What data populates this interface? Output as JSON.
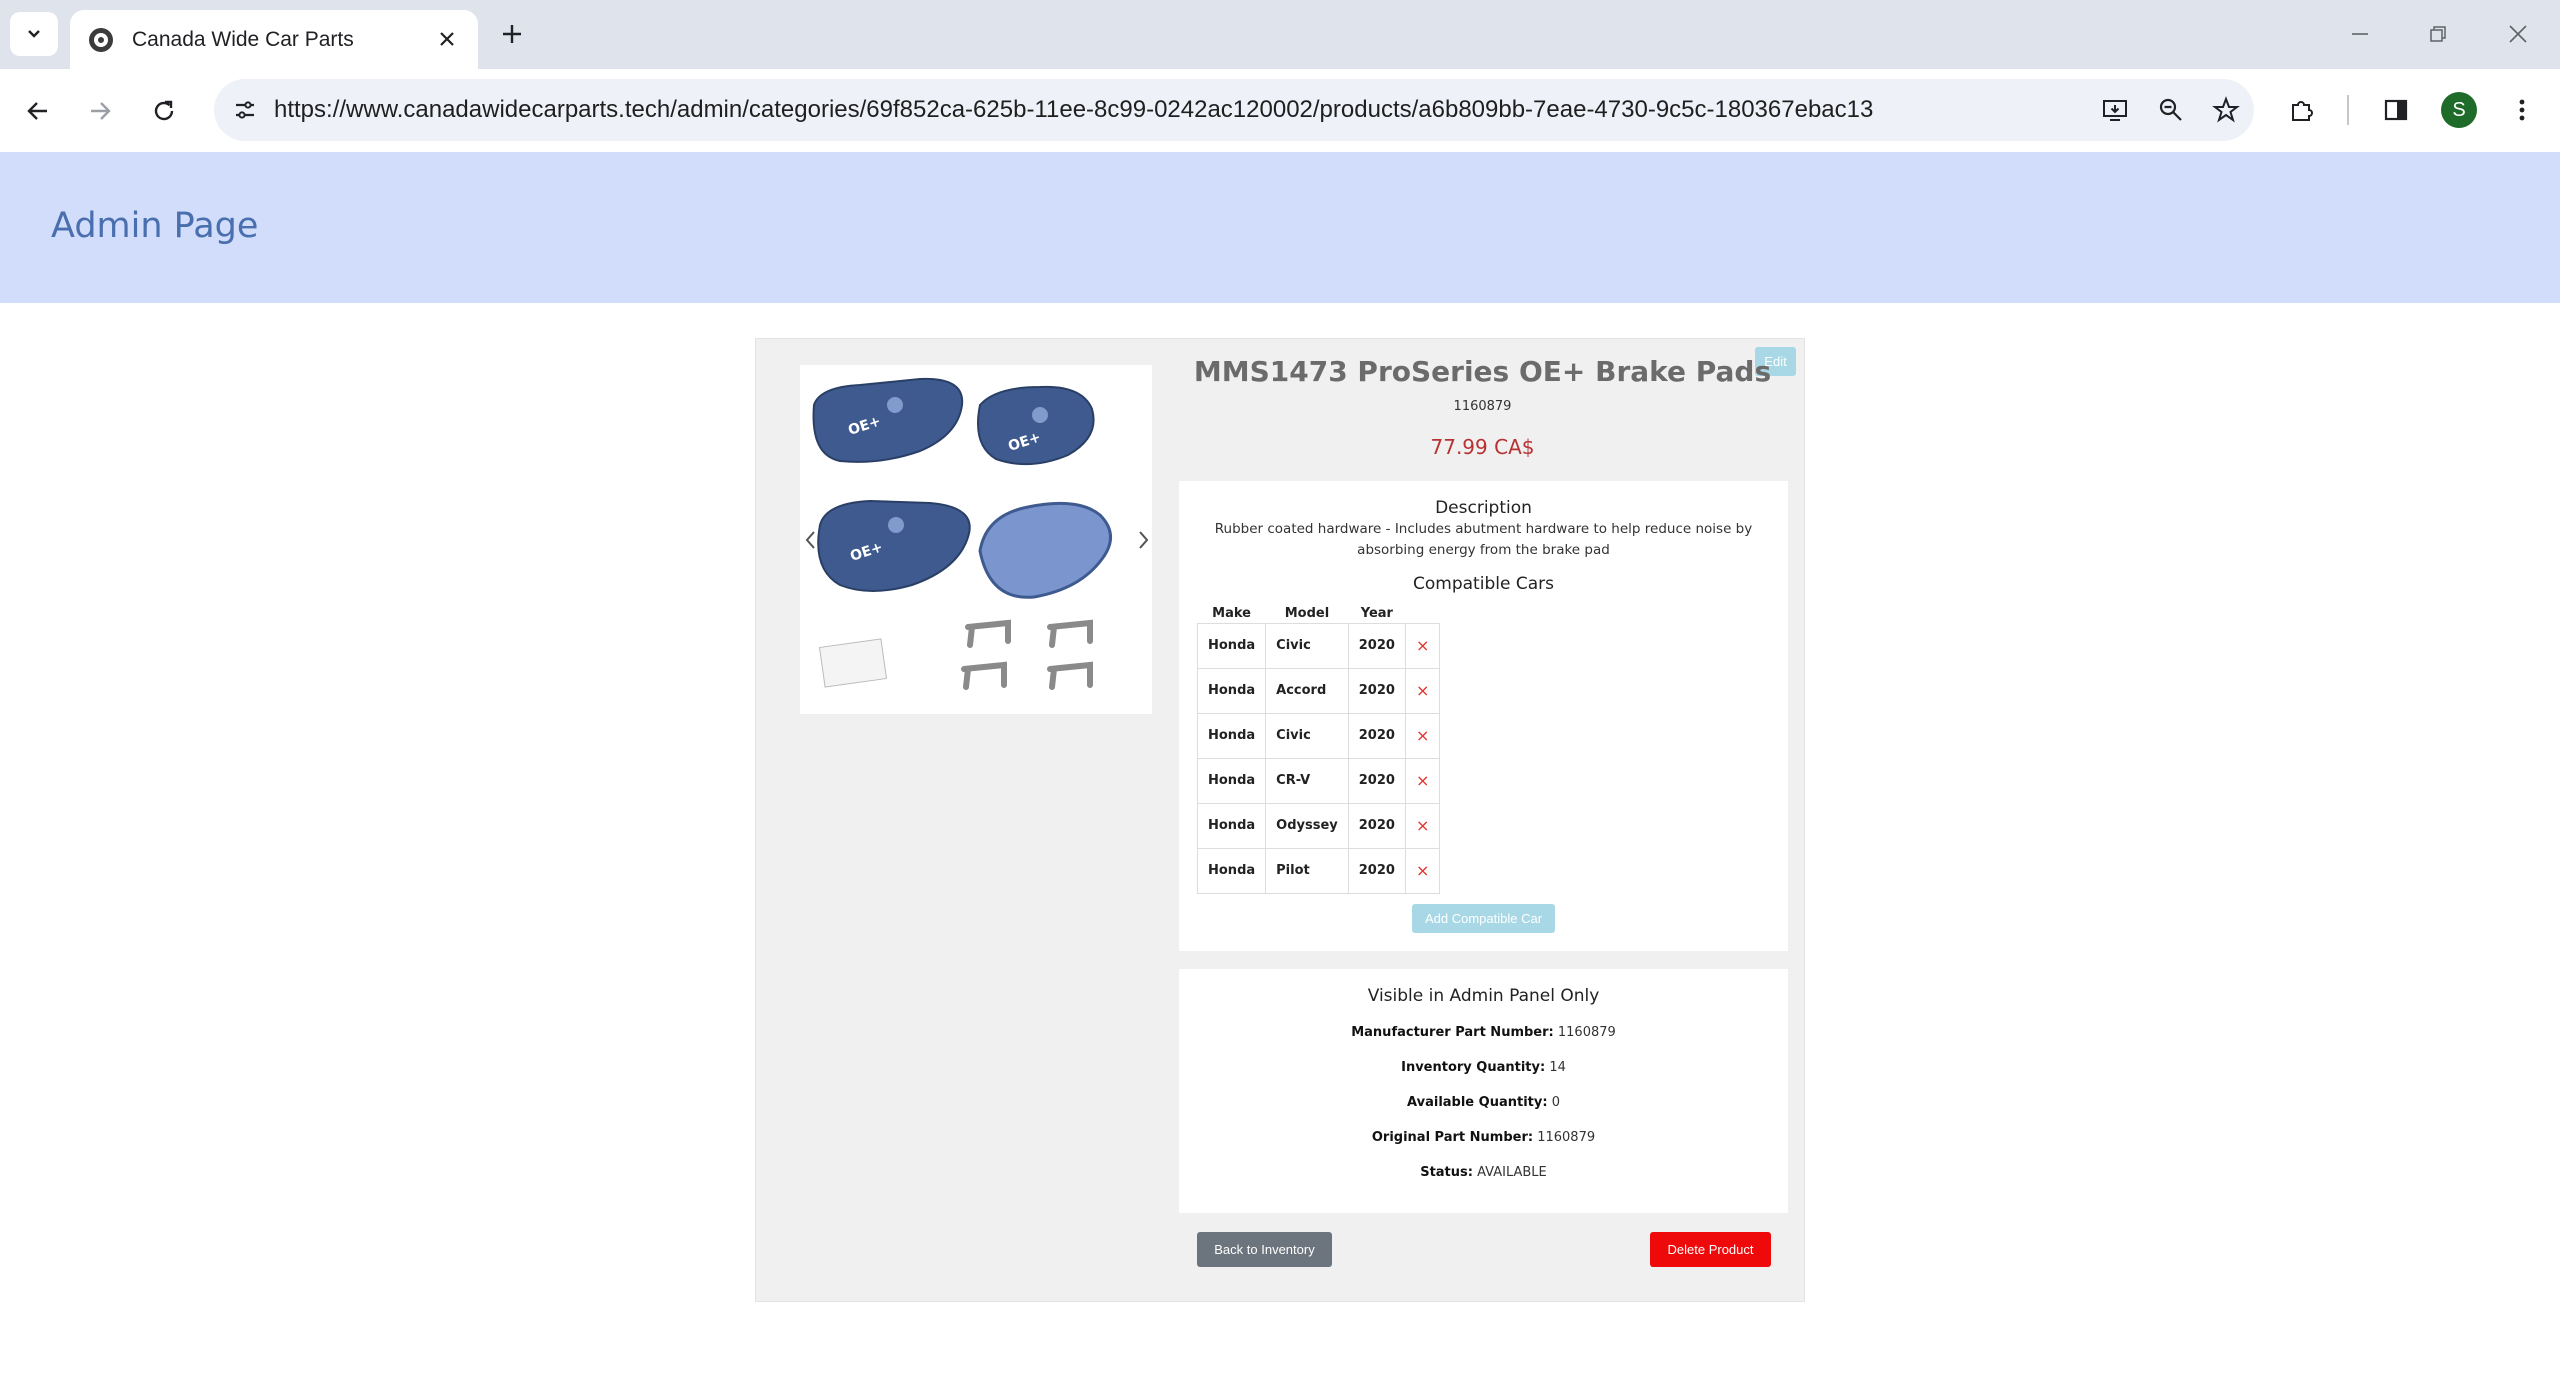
{
  "browser": {
    "tab": {
      "title": "Canada Wide Car Parts",
      "favicon": "tire-icon"
    },
    "url": "https://www.canadawidecarparts.tech/admin/categories/69f852ca-625b-11ee-8c99-0242ac120002/products/a6b809bb-7eae-4730-9c5c-180367ebac13",
    "profile_initial": "S",
    "colors": {
      "tabstrip": "#dee3ec",
      "omnibox": "#eef1f8",
      "avatar": "#1e6b2a"
    }
  },
  "header": {
    "title": "Admin Page"
  },
  "product": {
    "edit_label": "Edit",
    "title": "MMS1473 ProSeries OE+ Brake Pads",
    "sku": "1160879",
    "price": "77.99 CA$",
    "description_title": "Description",
    "description": "Rubber coated hardware - Includes abutment hardware to help reduce noise by absorbing energy from the brake pad",
    "compatible_title": "Compatible Cars",
    "columns": [
      "Make",
      "Model",
      "Year"
    ],
    "cars": [
      {
        "make": "Honda",
        "model": "Civic",
        "year": "2020",
        "remove": "×"
      },
      {
        "make": "Honda",
        "model": "Accord",
        "year": "2020",
        "remove": "×"
      },
      {
        "make": "Honda",
        "model": "Civic",
        "year": "2020",
        "remove": "×"
      },
      {
        "make": "Honda",
        "model": "CR-V",
        "year": "2020",
        "remove": "×"
      },
      {
        "make": "Honda",
        "model": "Odyssey",
        "year": "2020",
        "remove": "×"
      },
      {
        "make": "Honda",
        "model": "Pilot",
        "year": "2020",
        "remove": "×"
      }
    ],
    "add_car_label": "Add Compatible Car",
    "image_logo_text": "OE+"
  },
  "admin": {
    "title": "Visible in Admin Panel Only",
    "fields": [
      {
        "label": "Manufacturer Part Number:",
        "value": "1160879"
      },
      {
        "label": "Inventory Quantity:",
        "value": "14"
      },
      {
        "label": "Available Quantity:",
        "value": "0"
      },
      {
        "label": "Original Part Number:",
        "value": "1160879"
      },
      {
        "label": "Status:",
        "value": "AVAILABLE"
      }
    ]
  },
  "actions": {
    "back_label": "Back to Inventory",
    "delete_label": "Delete Product"
  },
  "colors": {
    "header_bg": "#d1ddfb",
    "header_text": "#4a6fae",
    "price": "#b83232",
    "delete": "#ee0a0a",
    "back": "#6c757d",
    "light_button": "#a8d8e6",
    "remove_x": "#e0342c"
  }
}
